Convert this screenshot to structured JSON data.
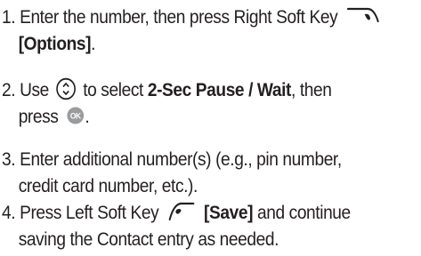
{
  "steps": [
    {
      "number": "1.",
      "line1_text": "Enter the number, then press Right Soft Key",
      "line2_bold": "[Options]",
      "line2_after": ".",
      "icon": "right-soft-key-icon"
    },
    {
      "number": "2.",
      "text_use": "Use",
      "text_to_select": "to select",
      "bold": "2-Sec Pause / Wait",
      "after_bold": ", then",
      "line2_text": "press",
      "line2_after": ".",
      "icons": [
        "navigation-key-icon",
        "ok-key-icon"
      ]
    },
    {
      "number": "3.",
      "line1_text": "Enter additional number(s) (e.g., pin number,",
      "line2_text": "credit card number, etc.)."
    },
    {
      "number": "4.",
      "text_before_icon": "Press Left Soft Key",
      "bold": "[Save]",
      "after_bold": "and continue",
      "line2_text": "saving the Contact entry as needed.",
      "icon": "left-soft-key-icon"
    }
  ],
  "ok_key_label": "OK"
}
